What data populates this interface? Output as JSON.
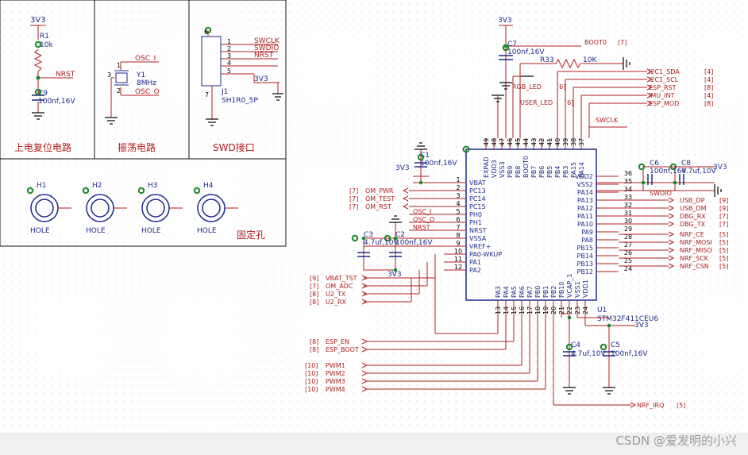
{
  "colors": {
    "wire": "#b31c1c",
    "label": "#b31c1c",
    "ref": "#1e2a8c",
    "body": "#1e2a8c",
    "pin": "#000000",
    "pad": "#1c8a2a",
    "background": "#ffffff"
  },
  "power": {
    "v33": "3V3"
  },
  "panels": {
    "reset": "上电复位电路",
    "osc": "振荡电路",
    "swd": "SWD接口",
    "holes": "固定孔"
  },
  "reset": {
    "r1_ref": "R1",
    "r1_val": "10k",
    "net": "NRST",
    "c9_ref": "C9",
    "c9_val": "100nf,16V"
  },
  "osc": {
    "y1_ref": "Y1",
    "y1_val": "8MHz",
    "net_in": "OSC_I",
    "net_out": "OSC_O",
    "pins": [
      "1",
      "2",
      "3"
    ]
  },
  "swd": {
    "j1_ref": "J1",
    "j1_val": "SH1R0_5P",
    "pins": [
      "1",
      "2",
      "3",
      "4",
      "5",
      "6",
      "7"
    ],
    "nets": [
      "SWCLK",
      "SWDIO",
      "NRST"
    ]
  },
  "holes": [
    {
      "ref": "H1",
      "val": "HOLE"
    },
    {
      "ref": "H2",
      "val": "HOLE"
    },
    {
      "ref": "H3",
      "val": "HOLE"
    },
    {
      "ref": "H4",
      "val": "HOLE"
    }
  ],
  "mcu": {
    "ref": "U1",
    "value": "STM32F411CEU6",
    "left_pins": [
      {
        "num": "1",
        "name": "VBAT"
      },
      {
        "num": "2",
        "name": "PC13"
      },
      {
        "num": "3",
        "name": "PC14"
      },
      {
        "num": "4",
        "name": "PC15"
      },
      {
        "num": "5",
        "name": "PH0"
      },
      {
        "num": "6",
        "name": "PH1"
      },
      {
        "num": "7",
        "name": "NRST"
      },
      {
        "num": "8",
        "name": "VSSA"
      },
      {
        "num": "9",
        "name": "VREF+"
      },
      {
        "num": "10",
        "name": "PA0-WKUP"
      },
      {
        "num": "11",
        "name": "PA1"
      },
      {
        "num": "12",
        "name": "PA2"
      }
    ],
    "right_pins": [
      {
        "num": "36",
        "name": "VDD2"
      },
      {
        "num": "35",
        "name": "VSS2"
      },
      {
        "num": "34",
        "name": "PA14"
      },
      {
        "num": "33",
        "name": "PA13"
      },
      {
        "num": "32",
        "name": "PA12"
      },
      {
        "num": "31",
        "name": "PA11"
      },
      {
        "num": "30",
        "name": "PA10"
      },
      {
        "num": "29",
        "name": "PA9"
      },
      {
        "num": "28",
        "name": "PA8"
      },
      {
        "num": "27",
        "name": "PB15"
      },
      {
        "num": "26",
        "name": "PB14"
      },
      {
        "num": "25",
        "name": "PB13"
      },
      {
        "num": "24",
        "name": "PB12"
      }
    ],
    "top_pins": [
      {
        "num": "49",
        "name": "EXPAD"
      },
      {
        "num": "48",
        "name": "VDD3"
      },
      {
        "num": "47",
        "name": "VSS3"
      },
      {
        "num": "46",
        "name": "PB9"
      },
      {
        "num": "45",
        "name": "PB8"
      },
      {
        "num": "44",
        "name": "BOOT0"
      },
      {
        "num": "43",
        "name": "PB7"
      },
      {
        "num": "42",
        "name": "PB6"
      },
      {
        "num": "41",
        "name": "PB5"
      },
      {
        "num": "40",
        "name": "PB4"
      },
      {
        "num": "39",
        "name": "PB3"
      },
      {
        "num": "38",
        "name": "PA15"
      },
      {
        "num": "37",
        "name": "PA14"
      }
    ],
    "bottom_pins": [
      {
        "num": "13",
        "name": "PA3"
      },
      {
        "num": "14",
        "name": "PA4"
      },
      {
        "num": "15",
        "name": "PA5"
      },
      {
        "num": "16",
        "name": "PA6"
      },
      {
        "num": "17",
        "name": "PA7"
      },
      {
        "num": "18",
        "name": "PB0"
      },
      {
        "num": "19",
        "name": "PB1"
      },
      {
        "num": "20",
        "name": "PB2"
      },
      {
        "num": "21",
        "name": "PB10"
      },
      {
        "num": "22",
        "name": "VCAP_1"
      },
      {
        "num": "23",
        "name": "VSS1"
      },
      {
        "num": "24",
        "name": "VDD1"
      }
    ]
  },
  "parts": {
    "c1": {
      "ref": "C1",
      "val": "100nf,16V"
    },
    "c2": {
      "ref": "C2",
      "val": "100nf,16V"
    },
    "c3": {
      "ref": "C3",
      "val": "4.7uf,10V"
    },
    "c4": {
      "ref": "C4",
      "val": "4.7uf,10V"
    },
    "c5": {
      "ref": "C5",
      "val": "100nf,16V"
    },
    "c6": {
      "ref": "C6",
      "val": "100nf,16V"
    },
    "c7": {
      "ref": "C7",
      "val": "100nf,16V"
    },
    "c8": {
      "ref": "C8",
      "val": "4.7uf,10V"
    },
    "r33": {
      "ref": "R33",
      "val": "10K"
    }
  },
  "left_nets": [
    {
      "tag": "[7]",
      "name": "OM_PWR"
    },
    {
      "tag": "[7]",
      "name": "OM_TEST"
    },
    {
      "tag": "[7]",
      "name": "OM_RST"
    },
    {
      "tag": "",
      "name": "OSC_I"
    },
    {
      "tag": "",
      "name": "OSC_O"
    },
    {
      "tag": "",
      "name": "NRST"
    }
  ],
  "left_bottom_nets": [
    {
      "tag": "[9]",
      "name": "VBAT_TST"
    },
    {
      "tag": "[7]",
      "name": "OM_ADC"
    },
    {
      "tag": "[8]",
      "name": "U2_TX"
    },
    {
      "tag": "[8]",
      "name": "U2_RX"
    }
  ],
  "esp_nets": [
    {
      "tag": "[8]",
      "name": "ESP_EN"
    },
    {
      "tag": "[8]",
      "name": "ESP_BOOT"
    }
  ],
  "pwm_nets": [
    {
      "tag": "[10]",
      "name": "PWM1"
    },
    {
      "tag": "[10]",
      "name": "PWM2"
    },
    {
      "tag": "[10]",
      "name": "PWM3"
    },
    {
      "tag": "[10]",
      "name": "PWM4"
    }
  ],
  "top_nets": [
    {
      "name": "BOOT0",
      "tag": "[7]"
    },
    {
      "name": "I2C1_SDA",
      "tag": "[4]"
    },
    {
      "name": "I2C1_SCL",
      "tag": "[4]"
    },
    {
      "name": "ESP_RST",
      "tag": "[8]"
    },
    {
      "name": "IMU_INT",
      "tag": "[4]"
    },
    {
      "name": "ESP_MOD",
      "tag": "[8]"
    },
    {
      "name": "RGB_LED",
      "tag": "[6]"
    },
    {
      "name": "USER_LED",
      "tag": "[6]"
    },
    {
      "name": "SWCLK",
      "tag": ""
    }
  ],
  "right_nets": [
    {
      "name": "SWDIO",
      "tag": ""
    },
    {
      "name": "USB_DP",
      "tag": "[9]"
    },
    {
      "name": "USB_DM",
      "tag": "[9]"
    },
    {
      "name": "DBG_RX",
      "tag": "[7]"
    },
    {
      "name": "DBG_TX",
      "tag": "[7]"
    },
    {
      "name": "NRF_CE",
      "tag": "[5]"
    },
    {
      "name": "NRF_MOSI",
      "tag": "[5]"
    },
    {
      "name": "NRF_MISO",
      "tag": "[5]"
    },
    {
      "name": "NRF_SCK",
      "tag": "[5]"
    },
    {
      "name": "NRF_CSN",
      "tag": "[5]"
    }
  ],
  "bottom_nets": [
    {
      "name": "NRF_IRQ",
      "tag": "[5]"
    }
  ],
  "watermark": "CSDN @爱发明的小兴"
}
